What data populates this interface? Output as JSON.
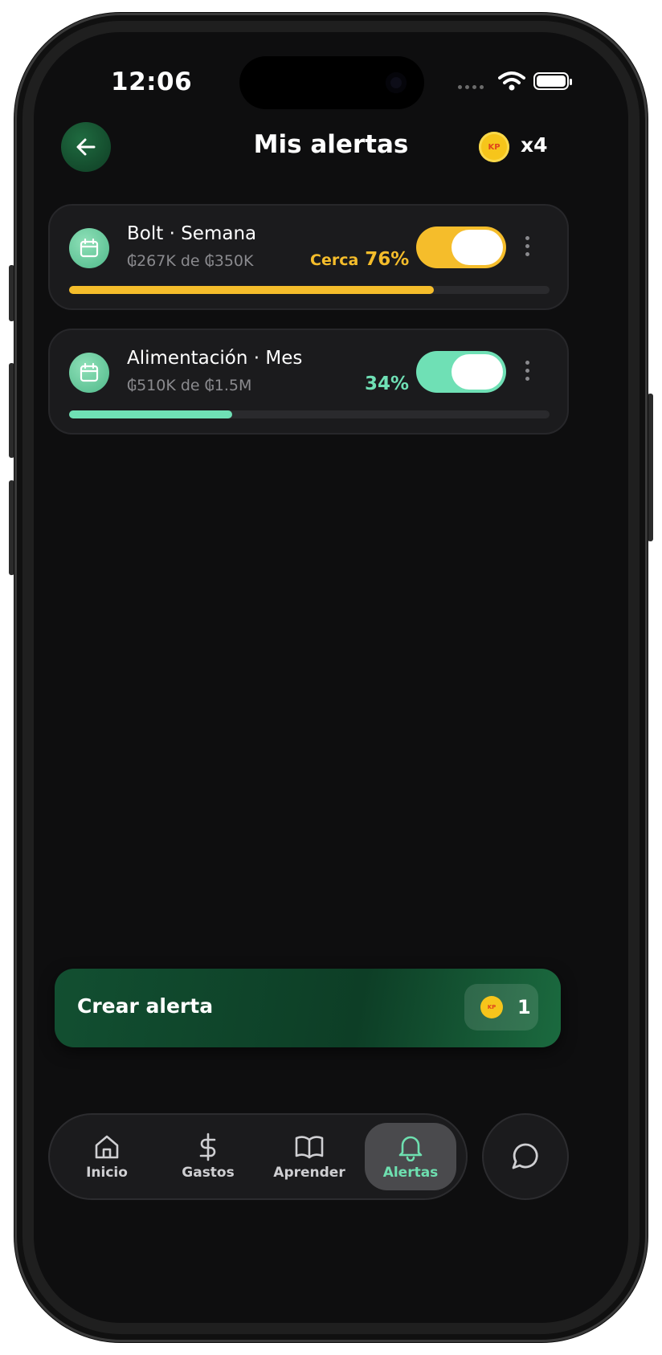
{
  "status_bar": {
    "time": "12:06"
  },
  "header": {
    "title": "Mis alertas",
    "coin_label": "KP",
    "coin_count": "x4"
  },
  "alerts": [
    {
      "title": "Bolt · Semana",
      "amount": "₲267K de ₲350K",
      "status_label": "Cerca",
      "percent_text": "76%",
      "progress": 0.76,
      "enabled": true,
      "color": "#f5bd2b"
    },
    {
      "title": "Alimentación · Mes",
      "amount": "₲510K de ₲1.5M",
      "status_label": "",
      "percent_text": "34%",
      "progress": 0.34,
      "enabled": true,
      "color": "#6fe0b5"
    }
  ],
  "create_alert": {
    "label": "Crear alerta",
    "coin_label": "KP",
    "cost": "1"
  },
  "nav": {
    "items": [
      {
        "label": "Inicio",
        "icon": "home-icon",
        "active": false
      },
      {
        "label": "Gastos",
        "icon": "dollar-icon",
        "active": false
      },
      {
        "label": "Aprender",
        "icon": "book-icon",
        "active": false
      },
      {
        "label": "Alertas",
        "icon": "bell-icon",
        "active": true
      }
    ],
    "chat_icon": "chat-icon"
  },
  "colors": {
    "background": "#0e0e0f",
    "accent_green": "#6fe0b5",
    "accent_yellow": "#f5bd2b"
  }
}
